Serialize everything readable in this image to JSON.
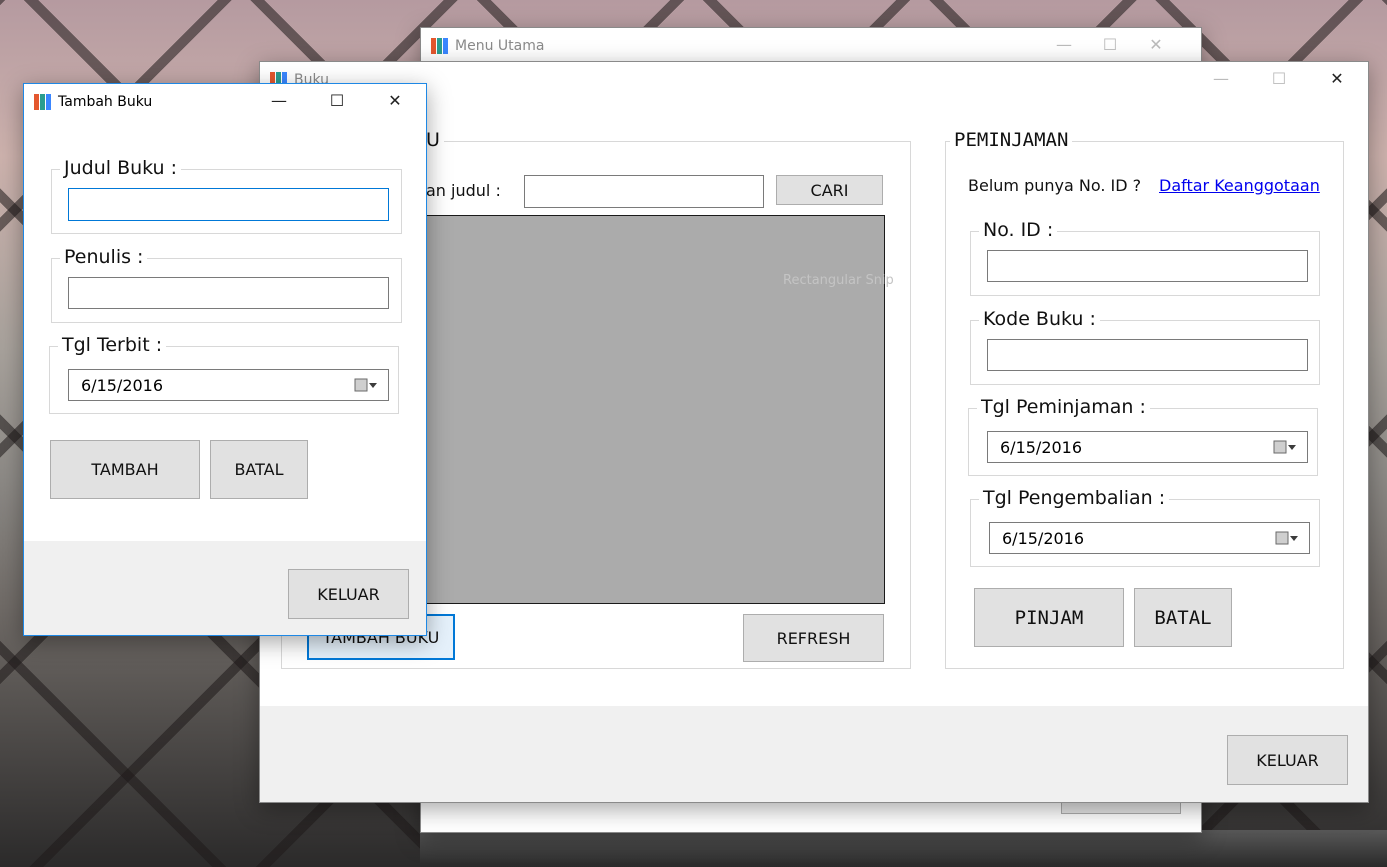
{
  "menu_utama": {
    "title": "Menu Utama"
  },
  "buku": {
    "title": "Buku",
    "search_group_label": "U",
    "search_label": "an judul :",
    "search_value": "",
    "search_button": "CARI",
    "grid_ghost_text": "Rectangular Snip",
    "tambah_buku_button": "TAMBAH BUKU",
    "refresh_button": "REFRESH",
    "keluar_button": "KELUAR",
    "peminjaman": {
      "group_label": "PEMINJAMAN",
      "belum_text": "Belum punya No. ID ?",
      "daftar_link": "Daftar Keanggotaan",
      "no_id_label": "No. ID :",
      "no_id_value": "",
      "kode_buku_label": "Kode Buku :",
      "kode_buku_value": "",
      "tgl_peminjaman_label": "Tgl Peminjaman :",
      "tgl_peminjaman_value": "6/15/2016",
      "tgl_pengembalian_label": "Tgl Pengembalian :",
      "tgl_pengembalian_value": "6/15/2016",
      "pinjam_button": "PINJAM",
      "batal_button": "BATAL"
    }
  },
  "tambah_buku": {
    "title": "Tambah Buku",
    "judul_label": "Judul Buku :",
    "judul_value": "",
    "penulis_label": "Penulis :",
    "penulis_value": "",
    "tgl_terbit_label": "Tgl Terbit :",
    "tgl_terbit_value": "6/15/2016",
    "tambah_button": "TAMBAH",
    "batal_button": "BATAL",
    "keluar_button": "KELUAR"
  },
  "window_controls": {
    "minimize": "—",
    "maximize": "☐",
    "close": "✕"
  },
  "colors": {
    "accent_focus": "#0078d7",
    "grid_background": "#ababab",
    "button_face": "#e1e1e1",
    "link": "#0000ee",
    "icon_teal": "#2a9d8f",
    "icon_red": "#e4572e",
    "icon_blue": "#3a86ff"
  }
}
